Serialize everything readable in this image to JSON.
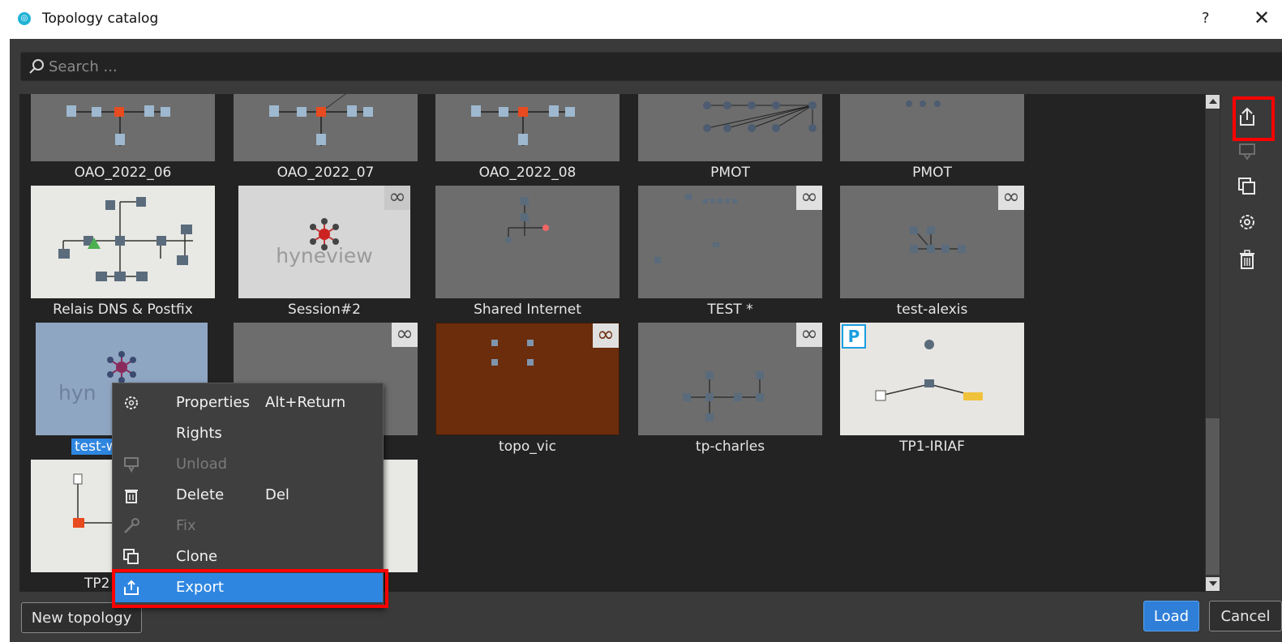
{
  "window": {
    "title": "Topology catalog",
    "help_label": "?",
    "close_label": "✕"
  },
  "search": {
    "placeholder": "Search ..."
  },
  "tiles": [
    {
      "name": "OAO_2022_06"
    },
    {
      "name": "OAO_2022_07"
    },
    {
      "name": "OAO_2022_08"
    },
    {
      "name": "PMOT"
    },
    {
      "name": "PMOT"
    },
    {
      "name": "Relais DNS & Postfix"
    },
    {
      "name": "Session#2",
      "thumb_text": "hyneview"
    },
    {
      "name": "Shared Internet"
    },
    {
      "name": "TEST *"
    },
    {
      "name": "test-alexis"
    },
    {
      "name": "test-w",
      "thumb_text": "hyn"
    },
    {
      "name": ""
    },
    {
      "name": "topo_vic"
    },
    {
      "name": "tp-charles"
    },
    {
      "name": "TP1-IRIAF",
      "badge": "P"
    },
    {
      "name": "TP2"
    },
    {
      "name": ""
    }
  ],
  "infinity_symbol": "∞",
  "context_menu": {
    "items": [
      {
        "label": "Properties",
        "shortcut": "Alt+Return",
        "icon": "gear-icon",
        "enabled": true
      },
      {
        "label": "Rights",
        "shortcut": "",
        "icon": "",
        "enabled": true
      },
      {
        "label": "Unload",
        "shortcut": "",
        "icon": "unload-icon",
        "enabled": false
      },
      {
        "label": "Delete",
        "shortcut": "Del",
        "icon": "trash-icon",
        "enabled": true
      },
      {
        "label": "Fix",
        "shortcut": "",
        "icon": "wrench-icon",
        "enabled": false
      },
      {
        "label": "Clone",
        "shortcut": "",
        "icon": "clone-icon",
        "enabled": true
      },
      {
        "label": "Export",
        "shortcut": "",
        "icon": "export-icon",
        "enabled": true,
        "selected": true
      }
    ]
  },
  "side_toolbar": [
    "export-icon",
    "unload-icon",
    "clone-icon",
    "gear-icon",
    "trash-icon"
  ],
  "buttons": {
    "new_topology": "New topology",
    "load": "Load",
    "cancel": "Cancel"
  },
  "colors": {
    "accent": "#2f86e0",
    "highlight": "#ff0000",
    "topo_vic_bg": "#6b2d0c"
  }
}
